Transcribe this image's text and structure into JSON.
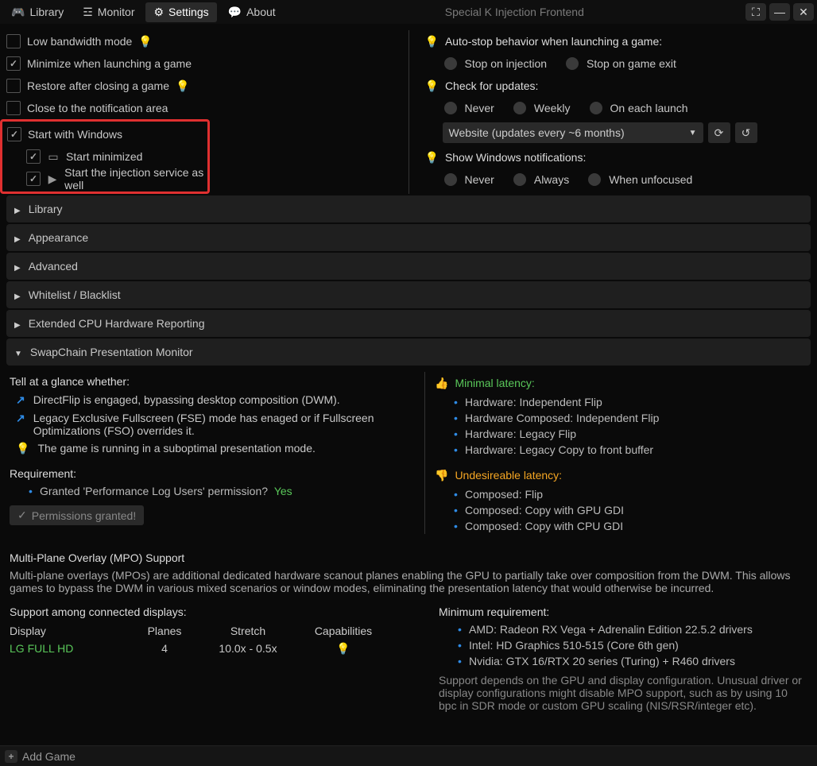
{
  "app_title": "Special K Injection Frontend",
  "tabs": [
    {
      "label": "Library"
    },
    {
      "label": "Monitor"
    },
    {
      "label": "Settings"
    },
    {
      "label": "About"
    }
  ],
  "left_settings": {
    "low_bandwidth": "Low bandwidth mode",
    "minimize_launch": "Minimize when launching a game",
    "restore_close": "Restore after closing a game",
    "close_notif": "Close to the notification area",
    "start_windows": "Start with Windows",
    "start_minimized": "Start minimized",
    "start_injection": "Start the injection service as well"
  },
  "right_settings": {
    "autostop_label": "Auto-stop behavior when launching a game:",
    "stop_injection": "Stop on injection",
    "stop_exit": "Stop on game exit",
    "updates_label": "Check for updates:",
    "never": "Never",
    "weekly": "Weekly",
    "each_launch": "On each launch",
    "update_channel": "Website (updates every ~6 months)",
    "notif_label": "Show Windows notifications:",
    "notif_never": "Never",
    "notif_always": "Always",
    "notif_unfocused": "When unfocused"
  },
  "sections": {
    "library": "Library",
    "appearance": "Appearance",
    "advanced": "Advanced",
    "whitelist": "Whitelist / Blacklist",
    "cpu": "Extended CPU Hardware Reporting",
    "swapchain": "SwapChain Presentation Monitor"
  },
  "swapchain": {
    "tell_glance": "Tell at a glance whether:",
    "directflip": "DirectFlip is engaged, bypassing desktop composition (DWM).",
    "legacy_fse": "Legacy Exclusive Fullscreen (FSE) mode has enaged or if Fullscreen Optimizations (FSO) overrides it.",
    "suboptimal": "The game is running in a suboptimal presentation mode.",
    "requirement": "Requirement:",
    "perm_q": "Granted 'Performance Log Users' permission?",
    "perm_yes": "Yes",
    "perm_granted": "Permissions granted!",
    "minimal_latency": "Minimal latency:",
    "ml1": "Hardware: Independent Flip",
    "ml2": "Hardware Composed: Independent Flip",
    "ml3": "Hardware: Legacy Flip",
    "ml4": "Hardware: Legacy Copy to front buffer",
    "undesirable": "Undesireable latency:",
    "ud1": "Composed: Flip",
    "ud2": "Composed: Copy with GPU GDI",
    "ud3": "Composed: Copy with CPU GDI"
  },
  "mpo": {
    "title": "Multi-Plane Overlay (MPO) Support",
    "desc": "Multi-plane overlays (MPOs) are additional dedicated hardware scanout planes enabling the GPU to partially take over composition from the DWM. This allows games to bypass the DWM in various mixed scenarios or window modes, eliminating the presentation latency that would otherwise be incurred.",
    "support_among": "Support among connected displays:",
    "h_display": "Display",
    "h_planes": "Planes",
    "h_stretch": "Stretch",
    "h_caps": "Capabilities",
    "display_name": "LG FULL HD",
    "planes_val": "4",
    "stretch_val": "10.0x - 0.5x",
    "min_req": "Minimum requirement:",
    "req1": "AMD: Radeon RX Vega + Adrenalin Edition 22.5.2 drivers",
    "req2": "Intel: HD Graphics 510-515 (Core 6th gen)",
    "req3": "Nvidia: GTX 16/RTX 20 series (Turing) + R460 drivers",
    "note": "Support depends on the GPU and display configuration. Unusual driver or display configurations might disable MPO support, such as by using 10 bpc in SDR mode or custom GPU scaling (NIS/RSR/integer etc)."
  },
  "footer": {
    "add_game": "Add Game"
  }
}
